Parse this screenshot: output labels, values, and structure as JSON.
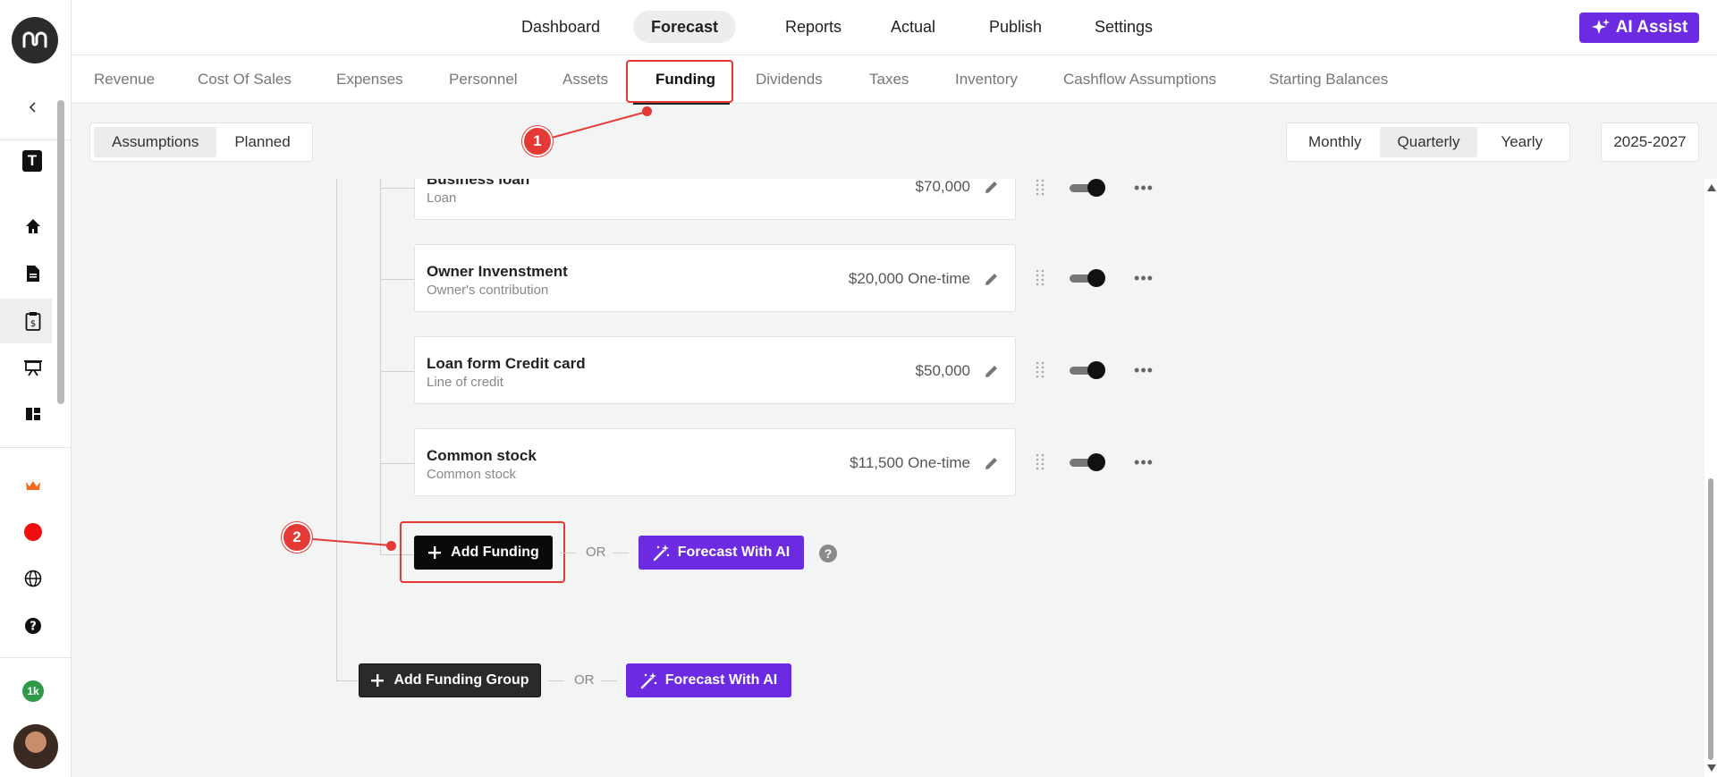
{
  "topnav": {
    "items": [
      "Dashboard",
      "Forecast",
      "Reports",
      "Actual",
      "Publish",
      "Settings"
    ],
    "ai_assist": "AI Assist"
  },
  "subtabs": [
    "Revenue",
    "Cost Of Sales",
    "Expenses",
    "Personnel",
    "Assets",
    "Funding",
    "Dividends",
    "Taxes",
    "Inventory",
    "Cashflow Assumptions",
    "Starting Balances"
  ],
  "toolbar": {
    "view_options": [
      "Assumptions",
      "Planned"
    ],
    "period_options": [
      "Monthly",
      "Quarterly",
      "Yearly"
    ],
    "year_range": "2025-2027"
  },
  "sidebar": {
    "t_badge": "T",
    "count_badge": "1k"
  },
  "funding_items": [
    {
      "title": "Business loan",
      "sub": "Loan",
      "amount": "$70,000"
    },
    {
      "title": "Owner Invenstment",
      "sub": "Owner's contribution",
      "amount": "$20,000 One-time"
    },
    {
      "title": "Loan form Credit card",
      "sub": "Line of credit",
      "amount": "$50,000"
    },
    {
      "title": "Common stock",
      "sub": "Common stock",
      "amount": "$11,500 One-time"
    }
  ],
  "actions": {
    "add_funding": "Add Funding",
    "or": "OR",
    "forecast_ai": "Forecast With AI",
    "add_group": "Add Funding Group",
    "help": "?"
  },
  "markers": [
    "1",
    "2"
  ]
}
